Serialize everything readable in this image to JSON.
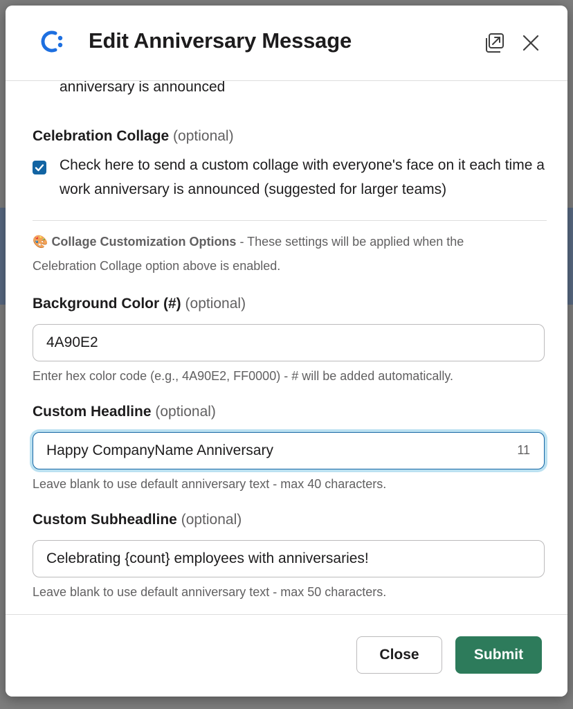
{
  "modal": {
    "title": "Edit Anniversary Message"
  },
  "content": {
    "clipped_text": "anniversary is announced",
    "collage": {
      "label": "Celebration Collage",
      "optional": "(optional)",
      "checked": true,
      "checkbox_text": "Check here to send a custom collage with everyone's face on it each time a work anniversary is announced (suggested for larger teams)"
    },
    "info": {
      "emoji": "🎨",
      "bold": "Collage Customization Options",
      "text": " - These settings will be applied when the Celebration Collage option above is enabled."
    },
    "background_color": {
      "label": "Background Color (#)",
      "optional": "(optional)",
      "value": "4A90E2",
      "hint": "Enter hex color code (e.g., 4A90E2, FF0000) - # will be added automatically."
    },
    "headline": {
      "label": "Custom Headline",
      "optional": "(optional)",
      "value": "Happy CompanyName Anniversary",
      "counter": "11",
      "hint": "Leave blank to use default anniversary text - max 40 characters."
    },
    "subheadline": {
      "label": "Custom Subheadline",
      "optional": "(optional)",
      "value": "Celebrating {count} employees with anniversaries!",
      "hint": "Leave blank to use default anniversary text - max 50 characters."
    }
  },
  "footer": {
    "close_label": "Close",
    "submit_label": "Submit"
  },
  "colors": {
    "accent_blue": "#1264a3",
    "submit_green": "#2d7b5b",
    "focus_ring": "#1d9bd1"
  }
}
